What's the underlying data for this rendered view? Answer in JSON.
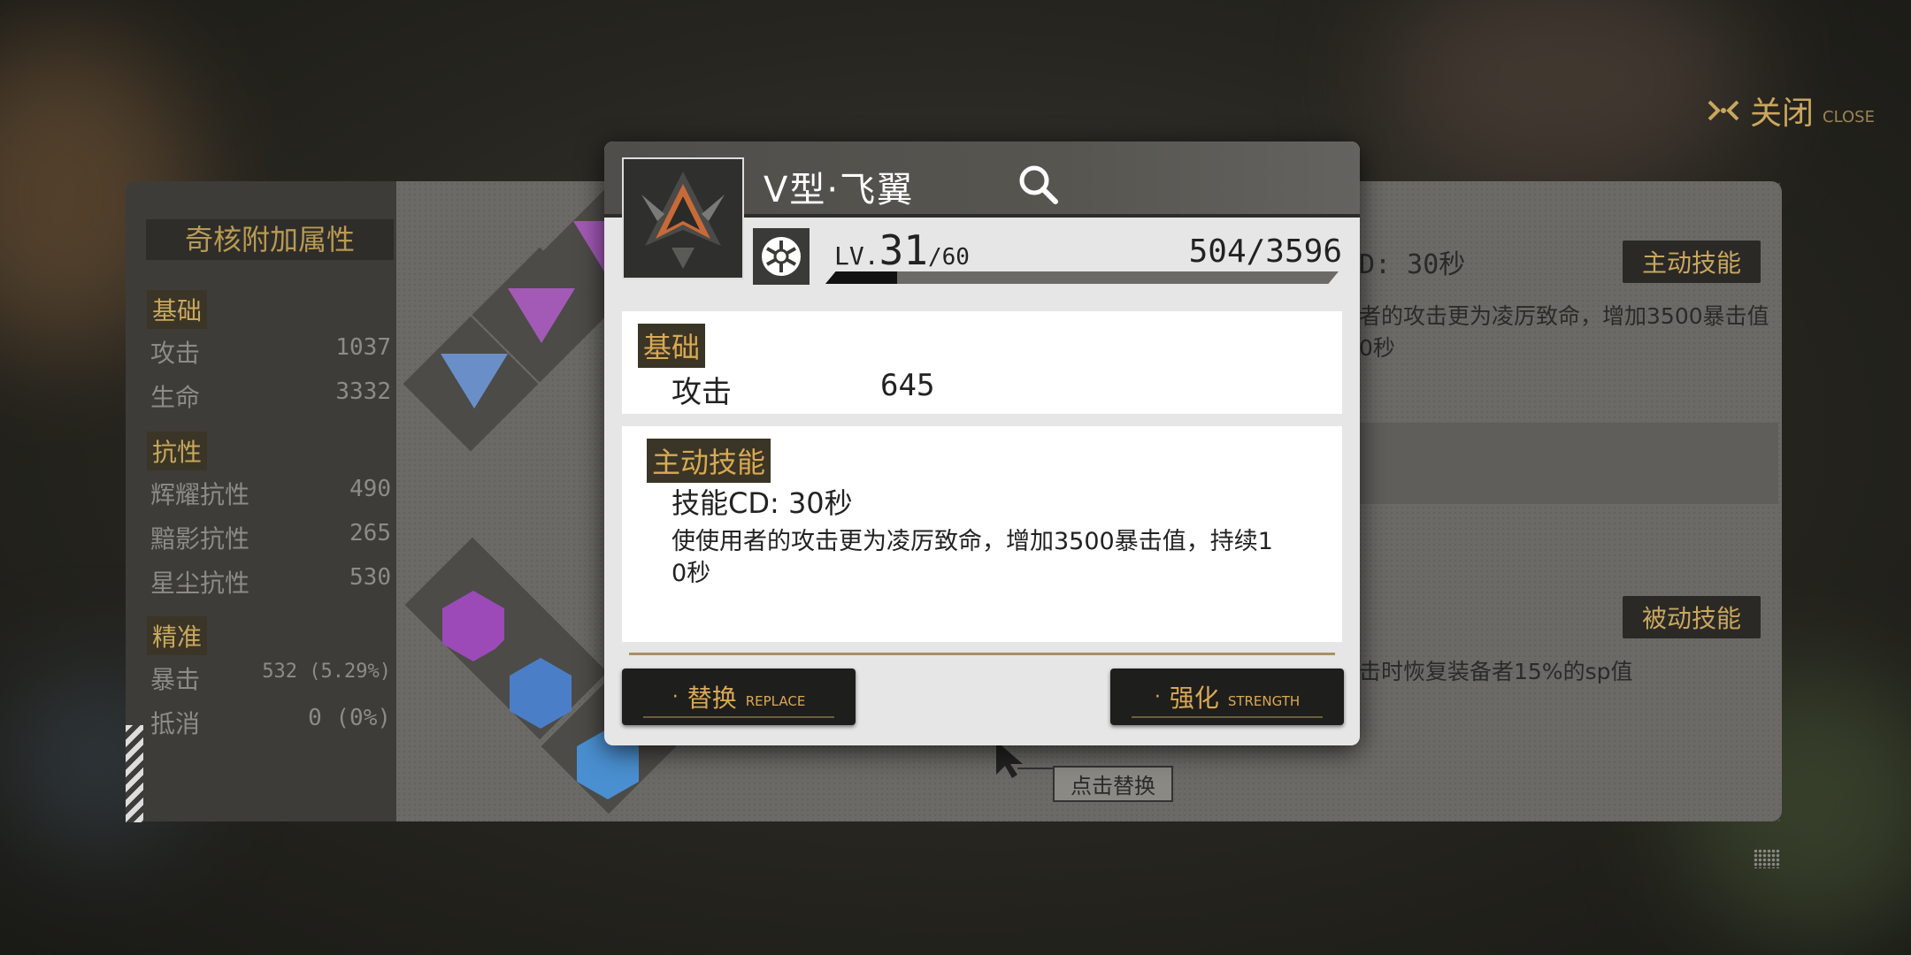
{
  "close": {
    "label": "关闭",
    "sub": "CLOSE"
  },
  "attributes": {
    "title": "奇核附加属性",
    "sections": [
      {
        "tag": "基础",
        "rows": [
          {
            "name": "攻击",
            "value": "1037"
          },
          {
            "name": "生命",
            "value": "3332"
          }
        ]
      },
      {
        "tag": "抗性",
        "rows": [
          {
            "name": "辉耀抗性",
            "value": "490"
          },
          {
            "name": "黯影抗性",
            "value": "265"
          },
          {
            "name": "星尘抗性",
            "value": "530"
          }
        ]
      },
      {
        "tag": "精准",
        "rows": [
          {
            "name": "暴击",
            "value": "532 (5.29%)"
          },
          {
            "name": "抵消",
            "value": "0 (0%)"
          }
        ]
      }
    ]
  },
  "right_panel": {
    "active_badge": "主动技能",
    "passive_badge": "被动技能",
    "cd_text": "D: 30秒",
    "active_desc_1": "者的攻击更为凌厉致命，增加3500暴击值",
    "active_desc_2": "0秒",
    "passive_desc": "击时恢复装备者15%的sp值",
    "hint": "点击替换"
  },
  "modal": {
    "item_name": "V型·飞翼",
    "level_label": "LV.",
    "level": "31",
    "level_max": "/60",
    "exp": "504/3596",
    "exp_progress": 0.14,
    "basic": {
      "tag": "基础",
      "stat_name": "攻击",
      "stat_value": "645"
    },
    "skill": {
      "tag": "主动技能",
      "cd": "技能CD: 30秒",
      "desc_line1": "使使用者的攻击更为凌厉致命，增加3500暴击值，持续1",
      "desc_line2": "0秒"
    },
    "buttons": {
      "replace": {
        "label": "替换",
        "sub": "REPLACE"
      },
      "enhance": {
        "label": "强化",
        "sub": "STRENGTH"
      }
    }
  }
}
